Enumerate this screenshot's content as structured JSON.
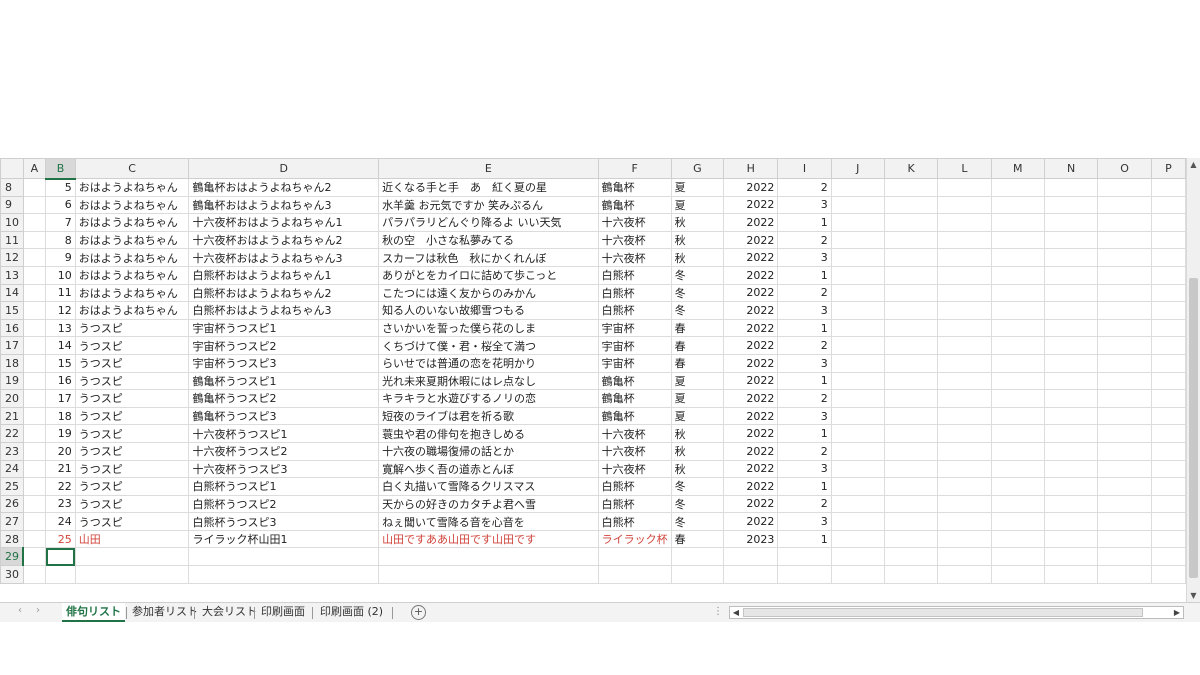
{
  "columns": [
    "",
    "A",
    "B",
    "C",
    "D",
    "E",
    "F",
    "G",
    "H",
    "I",
    "J",
    "K",
    "L",
    "M",
    "N",
    "O",
    "P"
  ],
  "rows": [
    {
      "r": "8",
      "b": "5",
      "c": "おはようよねちゃん",
      "d": "鶴亀杯おはようよねちゃん2",
      "e": "近くなる手と手　あ　紅く夏の星",
      "f": "鶴亀杯",
      "g": "夏",
      "h": "2022",
      "i": "2"
    },
    {
      "r": "9",
      "b": "6",
      "c": "おはようよねちゃん",
      "d": "鶴亀杯おはようよねちゃん3",
      "e": "水羊羹 お元気ですか 笑みぷるん",
      "f": "鶴亀杯",
      "g": "夏",
      "h": "2022",
      "i": "3"
    },
    {
      "r": "10",
      "b": "7",
      "c": "おはようよねちゃん",
      "d": "十六夜杯おはようよねちゃん1",
      "e": "パラパラリどんぐり降るよ いい天気",
      "f": "十六夜杯",
      "g": "秋",
      "h": "2022",
      "i": "1"
    },
    {
      "r": "11",
      "b": "8",
      "c": "おはようよねちゃん",
      "d": "十六夜杯おはようよねちゃん2",
      "e": "秋の空　小さな私夢みてる",
      "f": "十六夜杯",
      "g": "秋",
      "h": "2022",
      "i": "2"
    },
    {
      "r": "12",
      "b": "9",
      "c": "おはようよねちゃん",
      "d": "十六夜杯おはようよねちゃん3",
      "e": "スカーフは秋色　秋にかくれんぼ",
      "f": "十六夜杯",
      "g": "秋",
      "h": "2022",
      "i": "3"
    },
    {
      "r": "13",
      "b": "10",
      "c": "おはようよねちゃん",
      "d": "白熊杯おはようよねちゃん1",
      "e": "ありがとをカイロに詰めて歩こっと",
      "f": "白熊杯",
      "g": "冬",
      "h": "2022",
      "i": "1"
    },
    {
      "r": "14",
      "b": "11",
      "c": "おはようよねちゃん",
      "d": "白熊杯おはようよねちゃん2",
      "e": "こたつには遠く友からのみかん",
      "f": "白熊杯",
      "g": "冬",
      "h": "2022",
      "i": "2"
    },
    {
      "r": "15",
      "b": "12",
      "c": "おはようよねちゃん",
      "d": "白熊杯おはようよねちゃん3",
      "e": "知る人のいない故郷雪つもる",
      "f": "白熊杯",
      "g": "冬",
      "h": "2022",
      "i": "3"
    },
    {
      "r": "16",
      "b": "13",
      "c": "うつスピ",
      "d": "宇宙杯うつスピ1",
      "e": "さいかいを誓った僕ら花のしま",
      "f": "宇宙杯",
      "g": "春",
      "h": "2022",
      "i": "1"
    },
    {
      "r": "17",
      "b": "14",
      "c": "うつスピ",
      "d": "宇宙杯うつスピ2",
      "e": "くちづけて僕・君・桜全て満つ",
      "f": "宇宙杯",
      "g": "春",
      "h": "2022",
      "i": "2"
    },
    {
      "r": "18",
      "b": "15",
      "c": "うつスピ",
      "d": "宇宙杯うつスピ3",
      "e": "らいせでは普通の恋を花明かり",
      "f": "宇宙杯",
      "g": "春",
      "h": "2022",
      "i": "3"
    },
    {
      "r": "19",
      "b": "16",
      "c": "うつスピ",
      "d": "鶴亀杯うつスピ1",
      "e": "光れ未来夏期休暇にはレ点なし",
      "f": "鶴亀杯",
      "g": "夏",
      "h": "2022",
      "i": "1"
    },
    {
      "r": "20",
      "b": "17",
      "c": "うつスピ",
      "d": "鶴亀杯うつスピ2",
      "e": "キラキラと水遊びするノリの恋",
      "f": "鶴亀杯",
      "g": "夏",
      "h": "2022",
      "i": "2"
    },
    {
      "r": "21",
      "b": "18",
      "c": "うつスピ",
      "d": "鶴亀杯うつスピ3",
      "e": "短夜のライブは君を祈る歌",
      "f": "鶴亀杯",
      "g": "夏",
      "h": "2022",
      "i": "3"
    },
    {
      "r": "22",
      "b": "19",
      "c": "うつスピ",
      "d": "十六夜杯うつスピ1",
      "e": "蓑虫や君の俳句を抱きしめる",
      "f": "十六夜杯",
      "g": "秋",
      "h": "2022",
      "i": "1"
    },
    {
      "r": "23",
      "b": "20",
      "c": "うつスピ",
      "d": "十六夜杯うつスピ2",
      "e": "十六夜の職場復帰の話とか",
      "f": "十六夜杯",
      "g": "秋",
      "h": "2022",
      "i": "2"
    },
    {
      "r": "24",
      "b": "21",
      "c": "うつスピ",
      "d": "十六夜杯うつスピ3",
      "e": "寛解へ歩く吾の道赤とんぼ",
      "f": "十六夜杯",
      "g": "秋",
      "h": "2022",
      "i": "3"
    },
    {
      "r": "25",
      "b": "22",
      "c": "うつスピ",
      "d": "白熊杯うつスピ1",
      "e": "白く丸描いて雪降るクリスマス",
      "f": "白熊杯",
      "g": "冬",
      "h": "2022",
      "i": "1"
    },
    {
      "r": "26",
      "b": "23",
      "c": "うつスピ",
      "d": "白熊杯うつスピ2",
      "e": "天からの好きのカタチよ君へ雪",
      "f": "白熊杯",
      "g": "冬",
      "h": "2022",
      "i": "2"
    },
    {
      "r": "27",
      "b": "24",
      "c": "うつスピ",
      "d": "白熊杯うつスピ3",
      "e": "ねぇ聞いて雪降る音を心音を",
      "f": "白熊杯",
      "g": "冬",
      "h": "2022",
      "i": "3"
    },
    {
      "r": "28",
      "b": "25",
      "c": "山田",
      "d": "ライラック杯山田1",
      "e": "山田ですああ山田です山田です",
      "f": "ライラック杯",
      "g": "春",
      "h": "2023",
      "i": "1",
      "red": true
    },
    {
      "r": "29",
      "b": "",
      "c": "",
      "d": "",
      "e": "",
      "f": "",
      "g": "",
      "h": "",
      "i": ""
    },
    {
      "r": "30",
      "b": "",
      "c": "",
      "d": "",
      "e": "",
      "f": "",
      "g": "",
      "h": "",
      "i": ""
    }
  ],
  "tabs": [
    "俳句リスト",
    "参加者リスト",
    "大会リスト",
    "印刷画面",
    "印刷画面 (2)"
  ],
  "active_tab": 0,
  "selected_cell": "B29",
  "accent_color": "#217346",
  "highlight_color": "#d0453b",
  "icons": {
    "add_sheet": "plus-circle-icon",
    "tab_prev": "chevron-left-icon",
    "tab_next": "chevron-right-icon"
  }
}
